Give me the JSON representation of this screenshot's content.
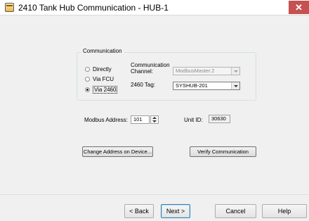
{
  "window": {
    "title": "2410 Tank Hub Communication - HUB-1",
    "close_label": "✕"
  },
  "communication": {
    "group_label": "Communication",
    "options": [
      {
        "label": "Directly",
        "checked": false
      },
      {
        "label": "Via FCU",
        "checked": false
      },
      {
        "label": "Via 2460",
        "checked": true
      }
    ],
    "channel_label_line1": "Communication",
    "channel_label_line2": "Channel:",
    "channel_value": "ModbusMaster.2",
    "tag_label": "2460 Tag:",
    "tag_value": "SYSHUB-201"
  },
  "modbus": {
    "address_label": "Modbus Address:",
    "address_value": "101",
    "unit_id_label": "Unit ID:",
    "unit_id_value": "30630"
  },
  "actions": {
    "change_address_label": "Change Address on Device...",
    "verify_label": "Verify Communication"
  },
  "footer": {
    "back_label": "< Back",
    "next_label": "Next >",
    "cancel_label": "Cancel",
    "help_label": "Help"
  }
}
